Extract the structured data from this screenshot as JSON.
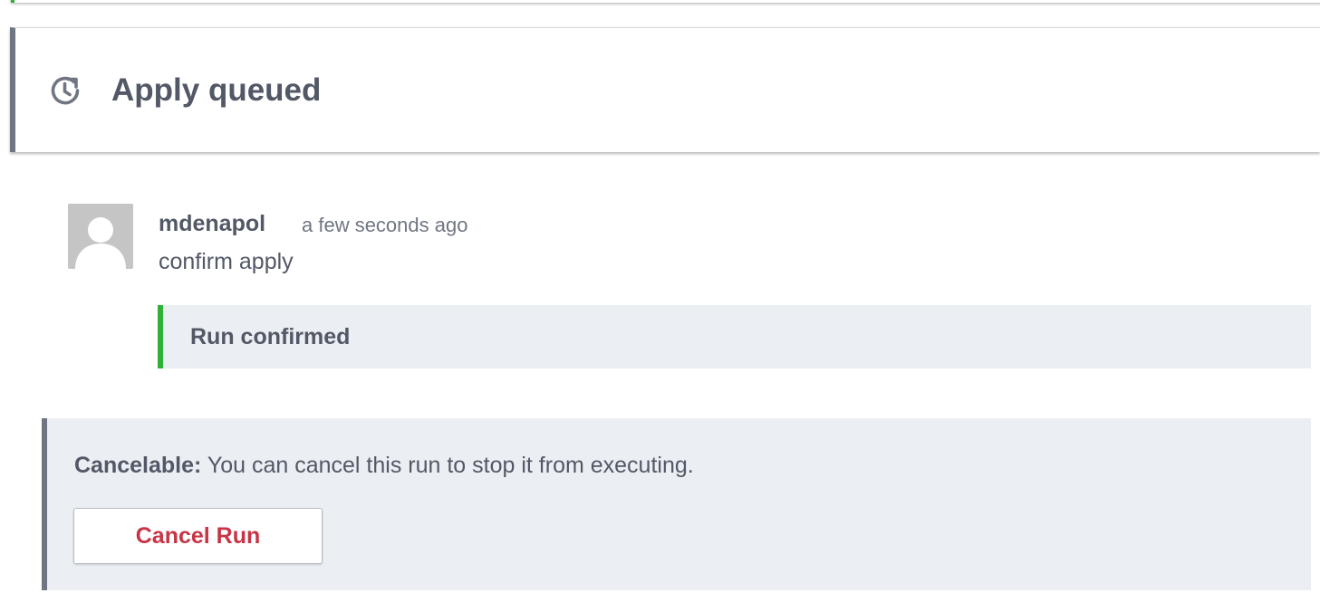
{
  "status": {
    "title": "Apply queued",
    "icon": "clock-refresh-icon"
  },
  "comment": {
    "author": "mdenapol",
    "time": "a few seconds ago",
    "body": "confirm apply",
    "avatar_icon": "default-user-avatar",
    "event": "Run confirmed"
  },
  "cancel_panel": {
    "label": "Cancelable:",
    "description": " You can cancel this run to stop it from executing.",
    "button_label": "Cancel Run"
  },
  "colors": {
    "success": "#2eb039",
    "danger": "#c73445",
    "neutral_border": "#6f7682",
    "panel_bg": "#ebeef2"
  }
}
